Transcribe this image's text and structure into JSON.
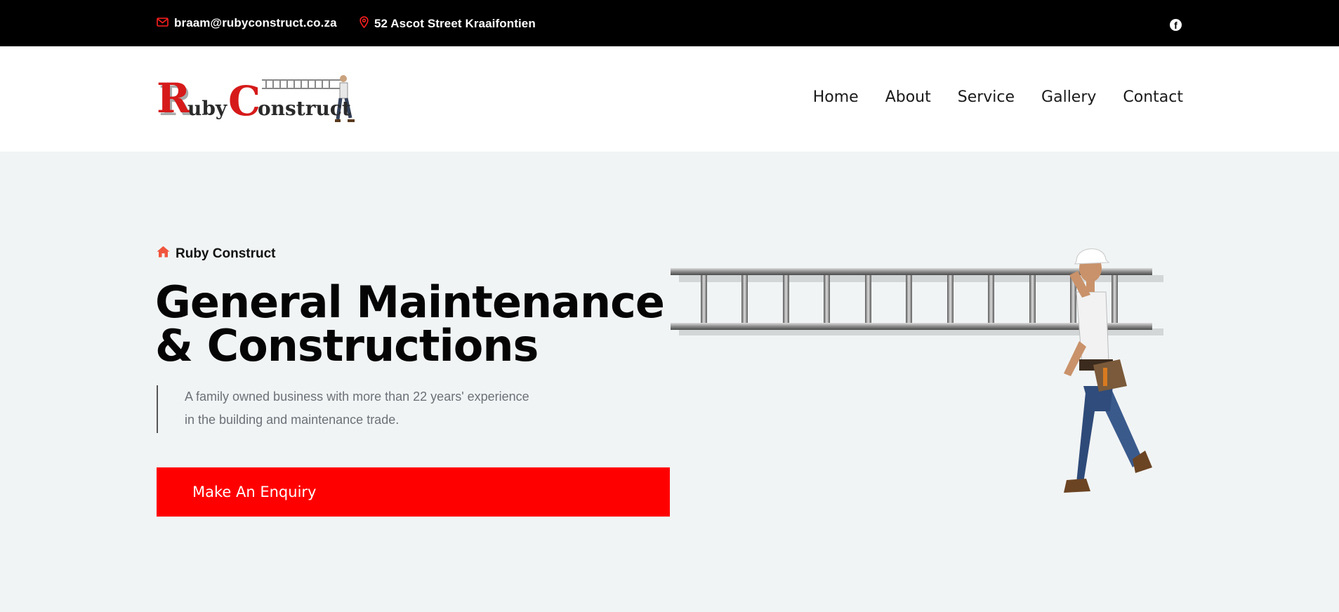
{
  "topbar": {
    "email": "braam@rubyconstruct.co.za",
    "address": "52 Ascot Street Kraaifontien",
    "email_icon": "mail-icon",
    "address_icon": "map-pin-icon",
    "social_icon": "facebook-icon"
  },
  "header": {
    "logo_text_ruby_r": "R",
    "logo_text_ruby_rest": "uby",
    "logo_text_construct_c": "C",
    "logo_text_construct_rest": "onstruct",
    "nav": [
      {
        "label": "Home"
      },
      {
        "label": "About"
      },
      {
        "label": "Service"
      },
      {
        "label": "Gallery"
      },
      {
        "label": "Contact"
      }
    ]
  },
  "hero": {
    "kicker": "Ruby Construct",
    "kicker_icon": "home-icon",
    "headline_line1": "General Maintenance",
    "headline_line2": "& Constructions",
    "description_line1": "A family owned business with more than 22 years' experience",
    "description_line2": "in the building and maintenance trade.",
    "cta_label": "Make An Enquiry",
    "image_icon": "worker-carrying-ladder-illustration"
  },
  "colors": {
    "accent": "#ff0000",
    "topbar_bg": "#000000",
    "hero_bg": "#f1f4f5",
    "text_dark": "#050505",
    "text_muted": "#6b7177"
  }
}
